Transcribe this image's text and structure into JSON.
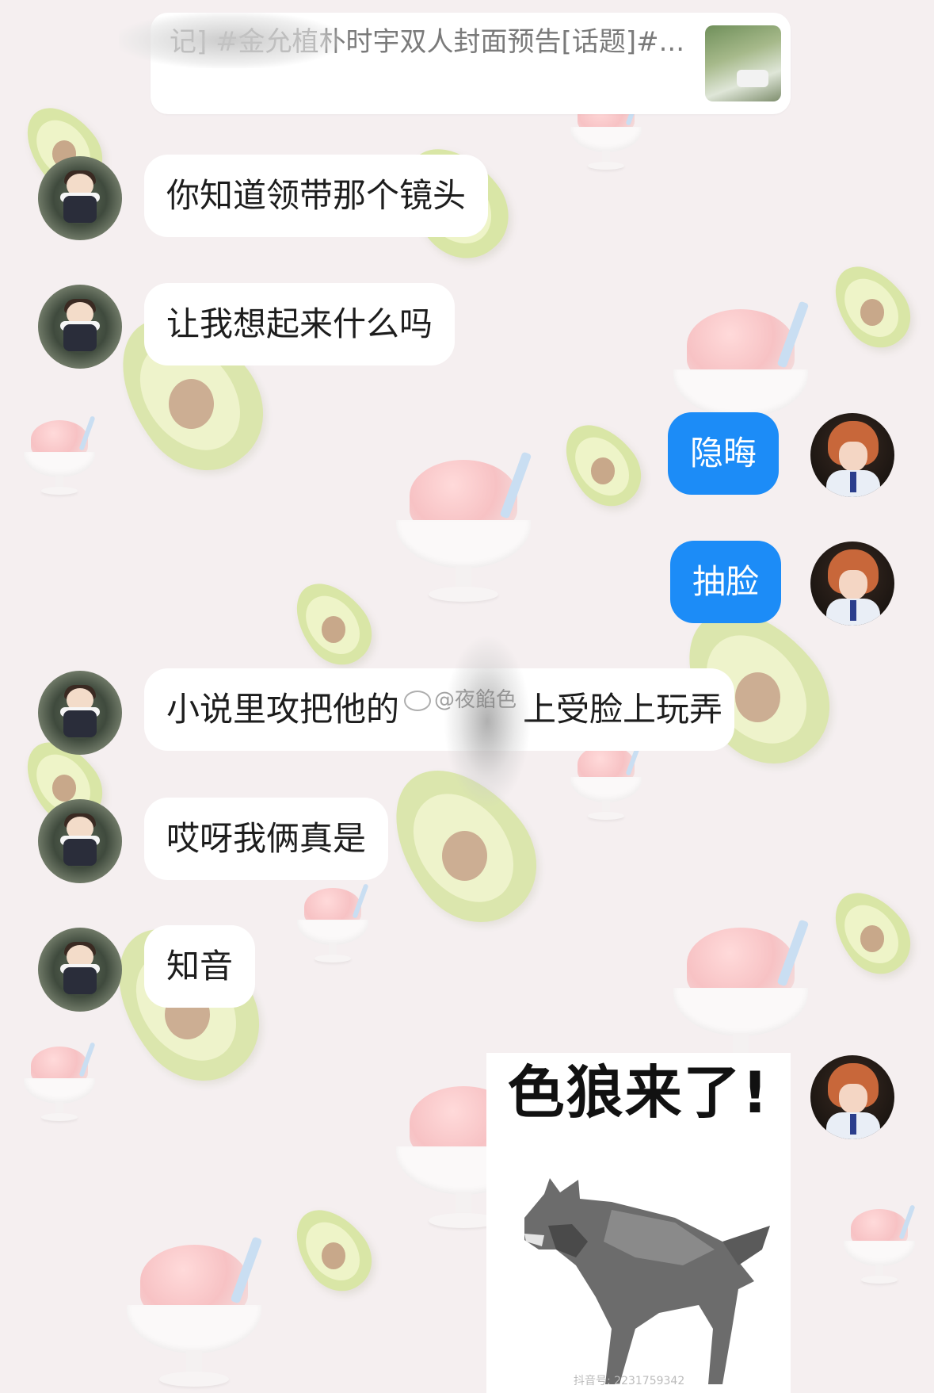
{
  "link_card": {
    "text": "记] #金允植朴时宇双人封面预告[话题]#..."
  },
  "messages": [
    {
      "side": "in",
      "text": "你知道领带那个镜头"
    },
    {
      "side": "in",
      "text": "让我想起来什么吗"
    },
    {
      "side": "out",
      "text": "隐晦"
    },
    {
      "side": "out",
      "text": "抽脸"
    },
    {
      "side": "in",
      "text": "小说里攻把他的"
    },
    {
      "side": "in",
      "text": "哎呀我俩真是"
    },
    {
      "side": "in",
      "text": "知音"
    }
  ],
  "message_5_tail": "上受脸上玩弄",
  "sticker": {
    "caption": "色狼来了!",
    "mark": "抖音号: 2231759342"
  },
  "watermark": "@夜餡色",
  "colors": {
    "background": "#f5eff0",
    "incoming_bubble": "#ffffff",
    "outgoing_bubble": "#1c8cf7"
  }
}
